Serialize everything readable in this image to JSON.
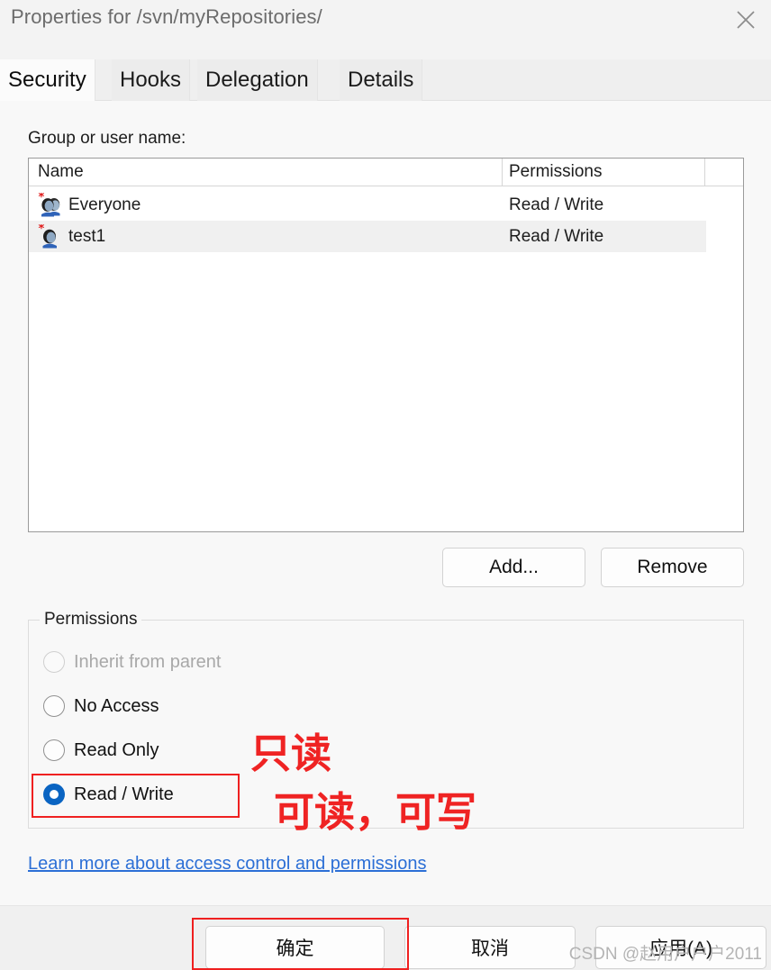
{
  "window": {
    "title": "Properties for /svn/myRepositories/",
    "close_icon": "close-icon"
  },
  "tabs": [
    {
      "label": "Security",
      "active": true
    },
    {
      "label": "Hooks",
      "active": false
    },
    {
      "label": "Delegation",
      "active": false
    },
    {
      "label": "Details",
      "active": false
    }
  ],
  "security": {
    "group_user_label": "Group or user name:",
    "columns": [
      "Name",
      "Permissions"
    ],
    "rows": [
      {
        "name": "Everyone",
        "permissions": "Read / Write",
        "icon": "group-users-icon",
        "selected": false
      },
      {
        "name": "test1",
        "permissions": "Read / Write",
        "icon": "single-user-icon",
        "selected": true
      }
    ],
    "add_button": "Add...",
    "remove_button": "Remove",
    "permissions_group_title": "Permissions",
    "permission_options": [
      {
        "label": "Inherit from parent",
        "checked": false,
        "disabled": true
      },
      {
        "label": "No Access",
        "checked": false,
        "disabled": false
      },
      {
        "label": "Read Only",
        "checked": false,
        "disabled": false
      },
      {
        "label": "Read / Write",
        "checked": true,
        "disabled": false
      }
    ],
    "help_link": "Learn more about access control and permissions"
  },
  "footer": {
    "ok_button": "确定",
    "cancel_button": "取消",
    "apply_button": "应用(A)"
  },
  "annotations": {
    "read_only_note": "只读",
    "read_write_note": "可读，可写",
    "highlight_color": "#ef2020"
  },
  "watermark": "CSDN @赵用户户户2011"
}
